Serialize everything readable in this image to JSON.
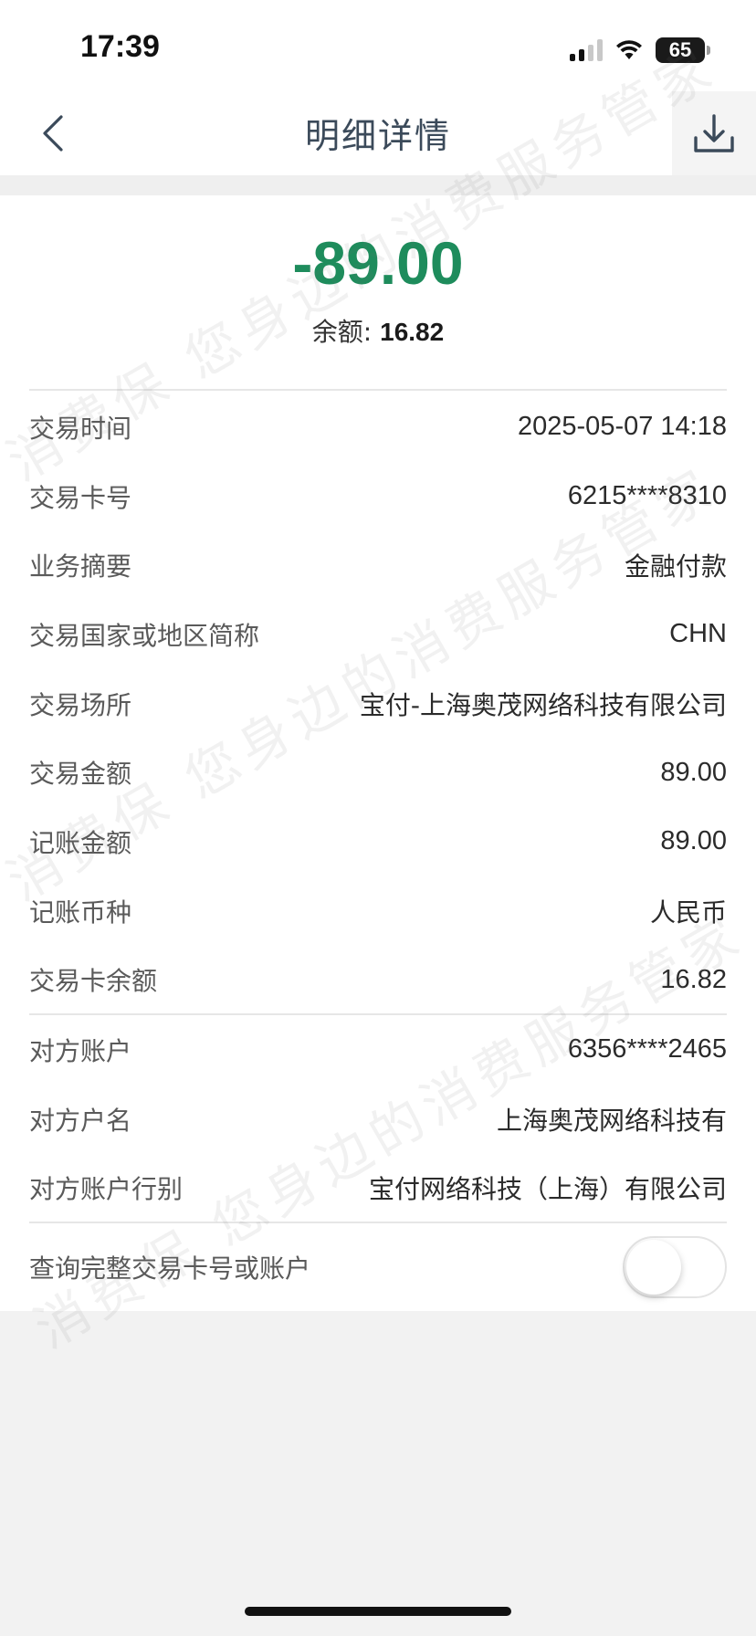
{
  "status_bar": {
    "time": "17:39",
    "battery": "65"
  },
  "nav": {
    "title": "明细详情",
    "back_icon": "chevron-left-icon",
    "download_icon": "download-icon"
  },
  "summary": {
    "amount": "-89.00",
    "amount_color": "#1e8c5c",
    "balance_label": "余额: ",
    "balance_value": "16.82"
  },
  "details": [
    {
      "label": "交易时间",
      "value": "2025-05-07 14:18"
    },
    {
      "label": "交易卡号",
      "value": "6215****8310"
    },
    {
      "label": "业务摘要",
      "value": "金融付款"
    },
    {
      "label": "交易国家或地区简称",
      "value": "CHN"
    },
    {
      "label": "交易场所",
      "value": "宝付-上海奥茂网络科技有限公司"
    },
    {
      "label": "交易金额",
      "value": "89.00"
    },
    {
      "label": "记账金额",
      "value": "89.00"
    },
    {
      "label": "记账币种",
      "value": "人民币"
    },
    {
      "label": "交易卡余额",
      "value": "16.82"
    }
  ],
  "counterparty": [
    {
      "label": "对方账户",
      "value": "6356****2465"
    },
    {
      "label": "对方户名",
      "value": "上海奥茂网络科技有"
    },
    {
      "label": "对方账户行别",
      "value": "宝付网络科技（上海）有限公司"
    }
  ],
  "query": {
    "label": "查询完整交易卡号或账户",
    "toggle_on": false
  },
  "watermark": {
    "text": "消费保 您身边的消费服务管家"
  }
}
